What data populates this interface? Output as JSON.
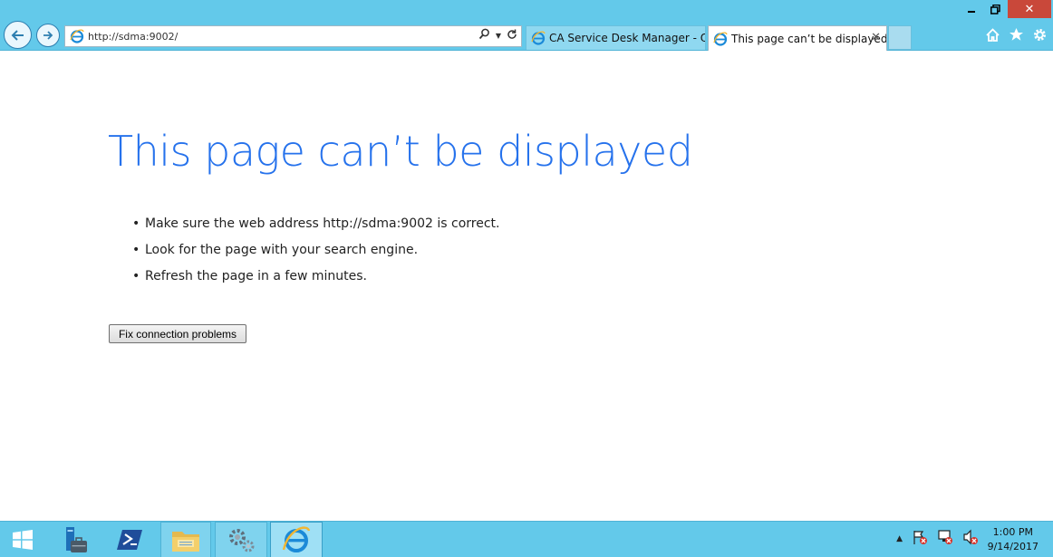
{
  "browser": {
    "address_url": "http://sdma:9002/",
    "tabs": [
      {
        "label": "CA Service Desk Manager - Op..."
      },
      {
        "label": "This page can’t be displayed"
      }
    ]
  },
  "page": {
    "title": "This page can’t be displayed",
    "tips": [
      "Make sure the web address http://sdma:9002 is correct.",
      "Look for the page with your search engine.",
      "Refresh the page in a few minutes."
    ],
    "fix_button_label": "Fix connection problems"
  },
  "taskbar": {
    "time": "1:00 PM",
    "date": "9/14/2017"
  },
  "colors": {
    "chrome": "#63c9ea",
    "title_blue": "#2672ec",
    "close_red": "#c9483a"
  },
  "icons": [
    "minimize-icon",
    "restore-icon",
    "close-icon",
    "back-arrow-icon",
    "forward-arrow-icon",
    "search-icon",
    "refresh-icon",
    "home-icon",
    "favorites-star-icon",
    "settings-gear-icon",
    "windows-start-icon",
    "server-manager-icon",
    "powershell-icon",
    "file-explorer-icon",
    "admin-tools-icon",
    "internet-explorer-icon",
    "action-center-flag-icon",
    "network-icon",
    "volume-muted-icon"
  ]
}
